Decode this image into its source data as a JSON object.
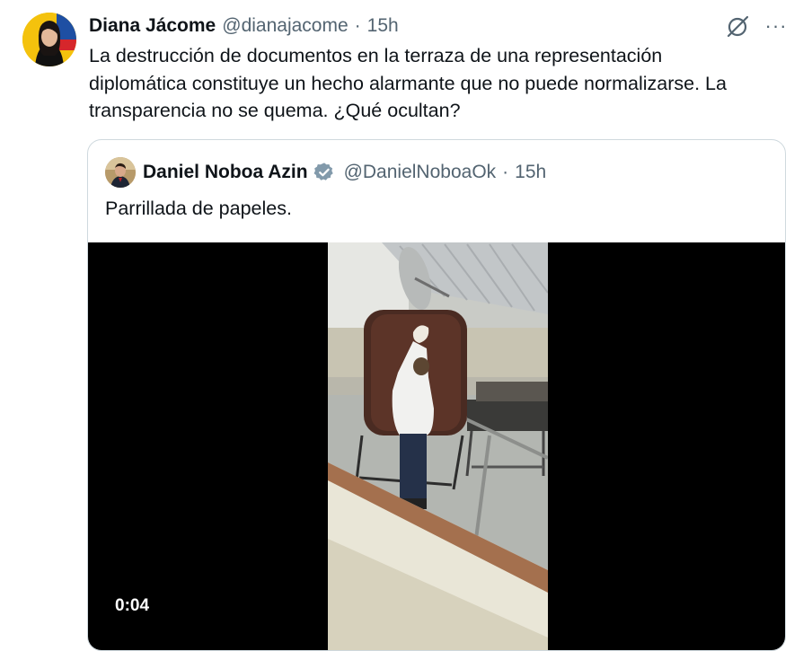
{
  "author": {
    "name": "Diana Jácome",
    "handle": "@dianajacome",
    "separator": "·",
    "time": "15h",
    "avatar_icon": "profile-avatar"
  },
  "actions": {
    "grok_icon": "grok-icon",
    "more_label": "···"
  },
  "tweet": {
    "line1": "La destrucción de documentos en la terraza de una representación",
    "line2": "diplomática constituye un hecho alarmante que no puede normalizarse. La",
    "line3": "transparencia no se quema. ¿Qué ocultan?"
  },
  "quoted": {
    "name": "Daniel Noboa Azin",
    "handle": "@DanielNoboaOk",
    "separator": "·",
    "time": "15h",
    "text": "Parrillada de papeles.",
    "verified_icon": "verified-badge-icon",
    "video": {
      "duration": "0:04"
    }
  },
  "colors": {
    "text": "#0f1419",
    "muted": "#536471",
    "border": "#cfd9de",
    "verified_badge": "#829aab"
  }
}
